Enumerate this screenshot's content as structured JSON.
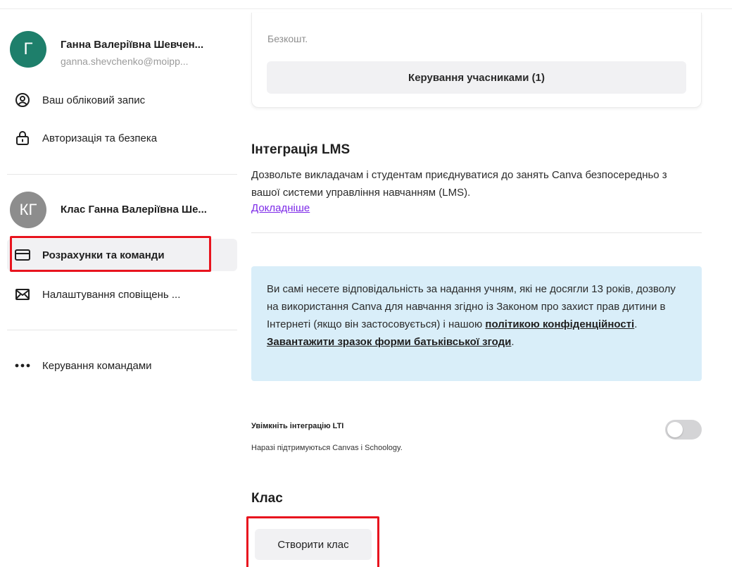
{
  "sidebar": {
    "user": {
      "avatar_initial": "Г",
      "name": "Ганна Валеріївна Шевчен...",
      "email": "ganna.shevchenko@moipp..."
    },
    "account_label": "Ваш обліковий запис",
    "auth_label": "Авторизація та безпека",
    "team": {
      "avatar_initials": "КГ",
      "name": "Клас Ганна Валеріївна Ше..."
    },
    "billing_label": "Розрахунки та команди",
    "notifications_label": "Налаштування сповіщень ...",
    "manage_teams_label": "Керування командами"
  },
  "plan_card": {
    "free_label": "Безкошт.",
    "manage_members_label": "Керування учасниками (1)"
  },
  "lms": {
    "title": "Інтеграція LMS",
    "description": "Дозвольте викладачам і студентам приєднуватися до занять Canva безпосередньо з вашої системи управління навчанням (LMS).",
    "learn_more": "Докладніше"
  },
  "notice": {
    "text_before": "Ви самі несете відповідальність за надання учням, які не досягли 13 років, дозволу на використання Canva для навчання згідно із Законом про захист прав дитини в Інтернеті (якщо він застосовується) і нашою ",
    "privacy_link": "політикою конфіденційності",
    "dot1": ".",
    "consent_link": "Завантажити зразок форми батьківської згоди",
    "dot2": "."
  },
  "lti": {
    "title": "Увімкніть інтеграцію LTI",
    "subtitle": "Наразі підтримуються Canvas і Schoology.",
    "enabled": false
  },
  "class_section": {
    "title": "Клас",
    "create_label": "Створити клас"
  },
  "colors": {
    "highlight": "#e8141e",
    "user_avatar": "#1e7f6b",
    "team_avatar": "#8d8d8d",
    "link": "#7d2ae8",
    "notice_bg": "#d9eef9"
  }
}
